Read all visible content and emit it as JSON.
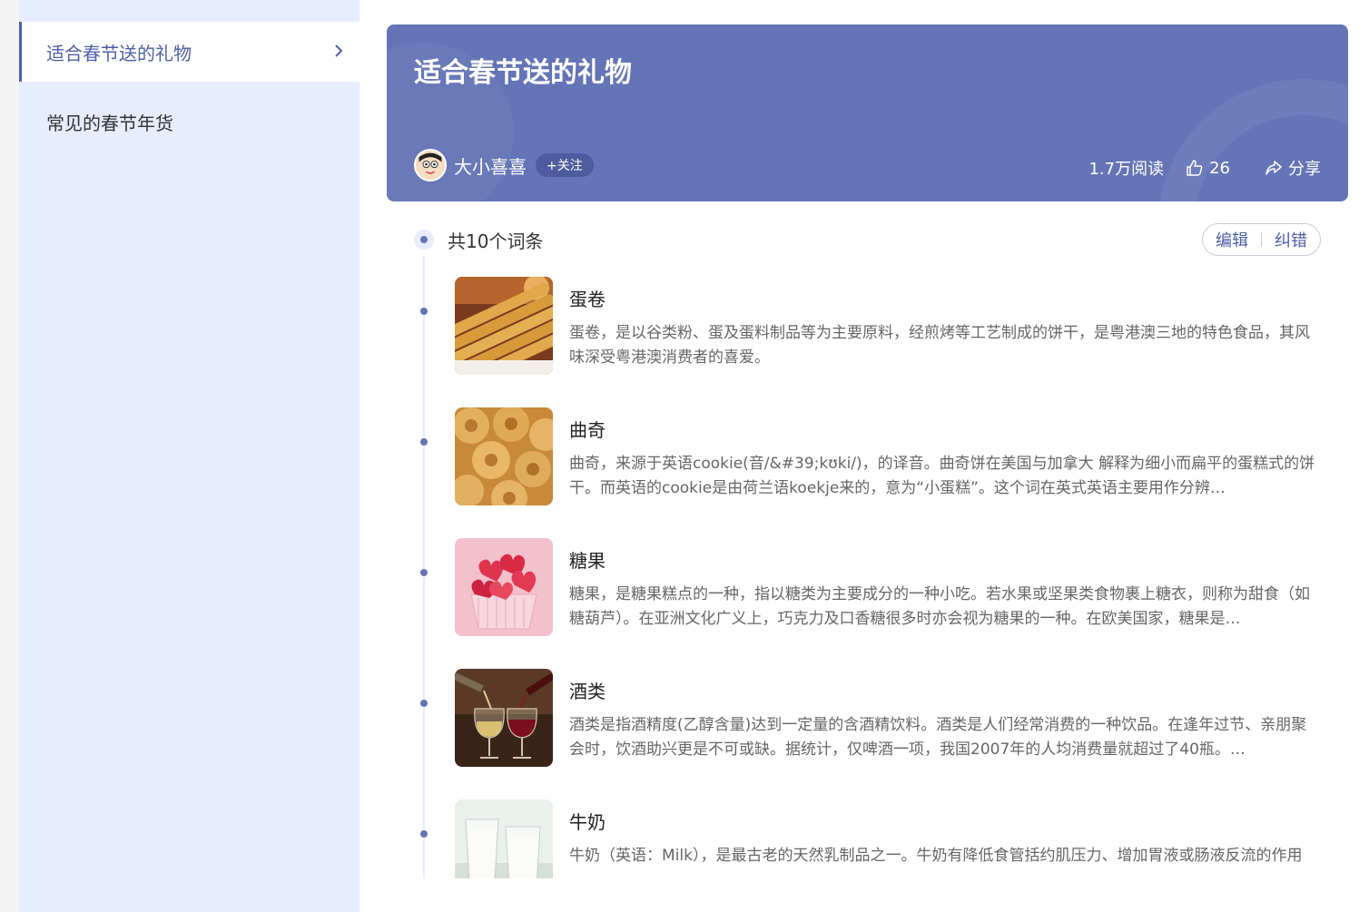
{
  "sidebar": {
    "items": [
      {
        "label": "适合春节送的礼物",
        "active": true
      },
      {
        "label": "常见的春节年货",
        "active": false
      }
    ]
  },
  "banner": {
    "title": "适合春节送的礼物",
    "author": "大小喜喜",
    "follow_label": "+关注",
    "reads": "1.7万阅读",
    "likes": "26",
    "share_label": "分享"
  },
  "list": {
    "count_label": "共10个词条",
    "edit_label": "编辑",
    "correct_label": "纠错",
    "entries": [
      {
        "title": "蛋卷",
        "desc": "蛋卷，是以谷类粉、蛋及蛋料制品等为主要原料，经煎烤等工艺制成的饼干，是粤港澳三地的特色食品，其风味深受粤港澳消费者的喜爱。",
        "thumb_icon": "egg-roll-image"
      },
      {
        "title": "曲奇",
        "desc": "曲奇，来源于英语cookie(音/&#39;kʊki/)，的译音。曲奇饼在美国与加拿大 解释为细小而扁平的蛋糕式的饼干。而英语的cookie是由荷兰语koekje来的，意为“小蛋糕”。这个词在英式英语主要用作分辨…",
        "thumb_icon": "cookie-image"
      },
      {
        "title": "糖果",
        "desc": "糖果，是糖果糕点的一种，指以糖类为主要成分的一种小吃。若水果或坚果类食物裹上糖衣，则称为甜食（如糖葫芦）。在亚洲文化广义上，巧克力及口香糖很多时亦会视为糖果的一种。在欧美国家，糖果是…",
        "thumb_icon": "candy-image"
      },
      {
        "title": "酒类",
        "desc": "酒类是指酒精度(乙醇含量)达到一定量的含酒精饮料。酒类是人们经常消费的一种饮品。在逢年过节、亲朋聚会时，饮酒助兴更是不可或缺。据统计，仅啤酒一项，我国2007年的人均消费量就超过了40瓶。…",
        "thumb_icon": "wine-image"
      },
      {
        "title": "牛奶",
        "desc": "牛奶（英语：Milk），是最古老的天然乳制品之一。牛奶有降低食管括约肌压力、增加胃液或肠液反流的作用",
        "thumb_icon": "milk-image"
      }
    ]
  },
  "colors": {
    "accent": "#4e5fa8",
    "banner": "#6474b6",
    "sidebar_bg": "#e6edff"
  }
}
